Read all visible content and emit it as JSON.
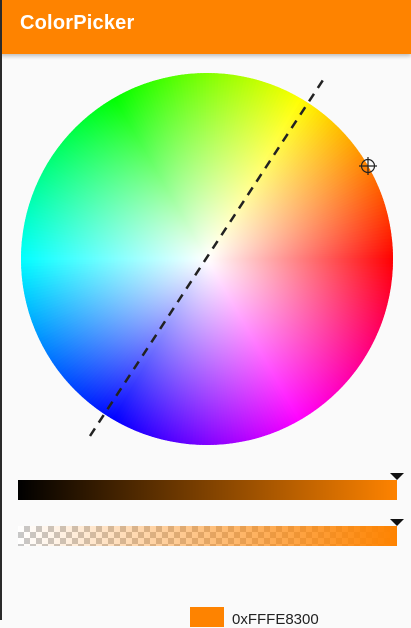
{
  "app_bar": {
    "title": "ColorPicker",
    "color": "#FE8300"
  },
  "picker": {
    "selected_color": "#FE8300",
    "hex_value": "0xFFFE8300",
    "brightness_percent": 100,
    "alpha_percent": 100,
    "has_preview_old_swatch": true
  },
  "icons": {
    "wheel_selector": "crosshair-icon",
    "slider_handle": "triangle-down-icon"
  }
}
